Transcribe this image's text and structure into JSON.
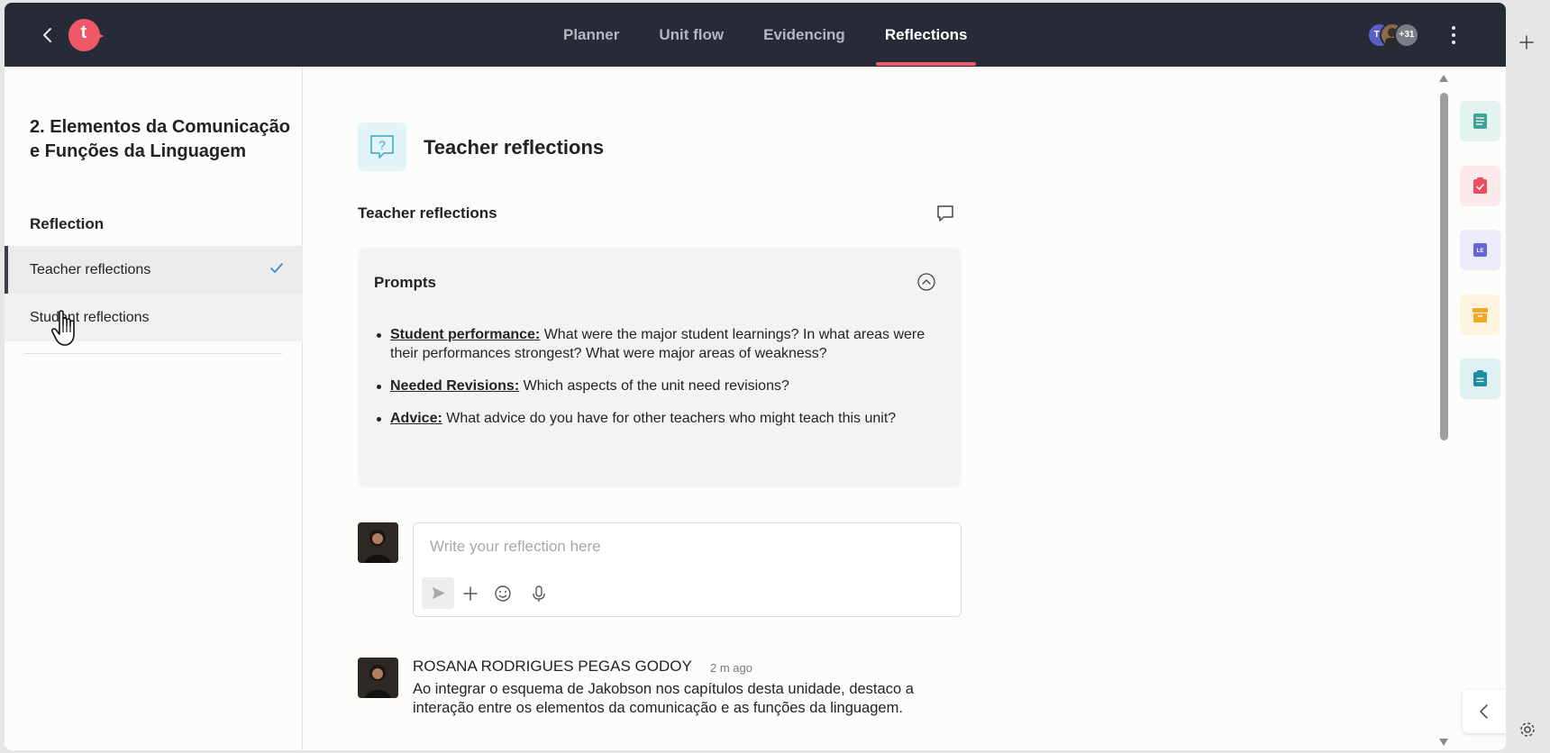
{
  "topbar": {
    "logo_letter": "t",
    "tabs": [
      {
        "label": "Planner"
      },
      {
        "label": "Unit flow"
      },
      {
        "label": "Evidencing"
      },
      {
        "label": "Reflections"
      }
    ],
    "avatars": [
      {
        "initials": "TS",
        "color": "#5a5fc8"
      },
      {
        "initials": "",
        "color": "#8a6a4a"
      },
      {
        "initials": "+31",
        "color": "#7a7d84"
      }
    ],
    "accent": "#ef5866"
  },
  "sidebar": {
    "unit_title": "2. Elementos da Comunicação e Funções da Linguagem",
    "section_label": "Reflection",
    "items": [
      {
        "label": "Teacher reflections",
        "completed": true
      },
      {
        "label": "Student reflections"
      }
    ]
  },
  "main": {
    "title": "Teacher reflections",
    "subtitle": "Teacher reflections",
    "prompts": {
      "title": "Prompts",
      "items": [
        {
          "bold": "Student performance:",
          "text": " What were the major student learnings? In what areas were their performances strongest? What were major areas of weakness?"
        },
        {
          "bold": "Needed Revisions:",
          "text": " Which aspects of the unit need revisions?"
        },
        {
          "bold": "Advice:",
          "text": " What advice do you have for other teachers who might teach this unit?"
        }
      ]
    },
    "composer": {
      "placeholder": "Write your reflection here",
      "value": ""
    },
    "comment": {
      "author": "ROSANA RODRIGUES PEGAS GODOY",
      "time": "2 m ago",
      "text": "Ao integrar o esquema de Jakobson nos capítulos desta unidade, destaco a interação entre os elementos da comunicação e as funções da linguagem."
    }
  },
  "rail": {
    "buttons": [
      {
        "icon": "list-document-icon",
        "bg": "#e3f3f0",
        "fg": "#3ea596"
      },
      {
        "icon": "clipboard-check-icon",
        "bg": "#fce9eb",
        "fg": "#e94e60"
      },
      {
        "icon": "le-badge-icon",
        "bg": "#ebebfb",
        "fg": "#6366d6"
      },
      {
        "icon": "archive-box-icon",
        "bg": "#fff4e0",
        "fg": "#f2a928"
      },
      {
        "icon": "clipboard-list-icon",
        "bg": "#dff0f3",
        "fg": "#1b8ea0"
      }
    ]
  }
}
